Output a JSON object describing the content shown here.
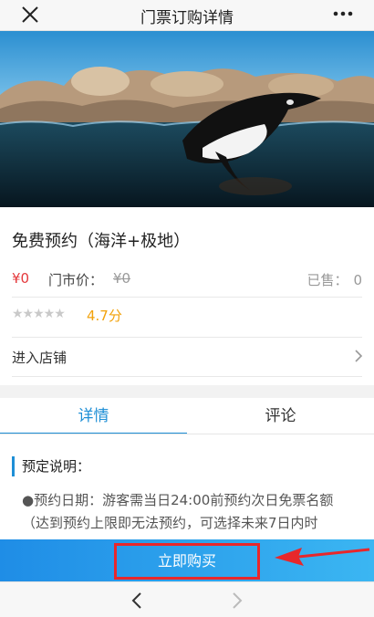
{
  "header": {
    "title": "门票订购详情",
    "close_icon": "close-icon",
    "more_icon": "more-icon"
  },
  "hero": {
    "description_icon": "penguin-photo"
  },
  "product": {
    "title": "免费预约（海洋+极地）",
    "price": "¥0",
    "market_label": "门市价：",
    "market_price": "¥0",
    "sold_label": "已售：",
    "sold_count": "0",
    "stars": "★★★★★",
    "rating": "4.7分",
    "store_label": "进入店铺"
  },
  "tabs": [
    {
      "label": "详情"
    },
    {
      "label": "评论"
    }
  ],
  "detail": {
    "section_title": "预定说明：",
    "lines": [
      "●预约日期：游客需当日24:00前预约次日免票名额",
      "（达到预约上限即无法预约，可选择未来7日内时"
    ]
  },
  "buy_bar": {
    "label": "立即购买"
  },
  "colors": {
    "accent": "#1e8fd6",
    "price_red": "#e4393c",
    "rating": "#f2a20b",
    "highlight": "#e8272b"
  }
}
